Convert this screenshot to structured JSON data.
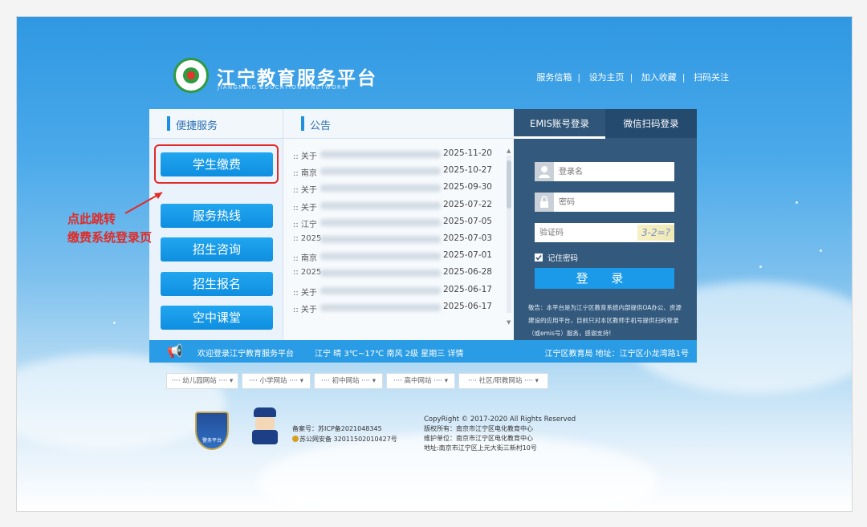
{
  "header": {
    "site_title": "江宁教育服务平台",
    "site_subtitle": "JIANGNING EDUCATION I NETWORK",
    "top_links": [
      "服务信箱",
      "设为主页",
      "加入收藏",
      "扫码关注"
    ]
  },
  "quick_services": {
    "heading": "便捷服务",
    "buttons": [
      "学生缴费",
      "服务热线",
      "招生咨询",
      "招生报名",
      "空中课堂"
    ]
  },
  "notices": {
    "heading": "公告",
    "items": [
      {
        "prefix": ":: 关于",
        "date": "2025-11-20"
      },
      {
        "prefix": ":: 南京",
        "date": "2025-10-27"
      },
      {
        "prefix": ":: 关于",
        "date": "2025-09-30"
      },
      {
        "prefix": ":: 关于",
        "date": "2025-07-22"
      },
      {
        "prefix": ":: 江宁",
        "date": "2025-07-05"
      },
      {
        "prefix": ":: 2025",
        "date": "2025-07-03"
      },
      {
        "prefix": ":: 南京",
        "date": "2025-07-01"
      },
      {
        "prefix": ":: 2025",
        "date": "2025-06-28"
      },
      {
        "prefix": ":: 关于",
        "date": "2025-06-17"
      },
      {
        "prefix": ":: 关于",
        "date": "2025-06-17"
      }
    ]
  },
  "login": {
    "tab_emis": "EMIS账号登录",
    "tab_wechat": "微信扫码登录",
    "username_placeholder": "登录名",
    "password_placeholder": "密码",
    "captcha_placeholder": "验证码",
    "captcha_text": "3-2=?",
    "remember_label": "记住密码",
    "login_button": "登 录",
    "note": "敬告：本平台是为江宁区教育系统内部提供OA办公、资源建设的应用平台，目前只对本区教师手机号提供扫码登录（或emis号）服务，感谢支持!"
  },
  "strip": {
    "welcome": "欢迎登录江宁教育服务平台",
    "weather": "江宁  晴 3℃~17℃  南风 2级  星期三  详情",
    "address": "江宁区教育局 地址：江宁区小龙湾路1号"
  },
  "dropdowns": [
    "···· 幼儿园网站 ···· ▾",
    "···· 小学网站 ···· ▾",
    "···· 初中网站 ···· ▾",
    "···· 高中网站 ···· ▾",
    "···· 社区/职教网站 ···· ▾"
  ],
  "footer": {
    "badge_text": "警务平台",
    "icp": "备案号：苏ICP备2021048345",
    "police": "苏公网安备 32011502010427号",
    "copyright": "CopyRight © 2017-2020 All Rights Reserved",
    "owner": "版权所有：南京市江宁区电化教育中心",
    "maintainer": "维护单位：南京市江宁区电化教育中心",
    "address": "地址:南京市江宁区上元大街三新村10号"
  },
  "annotation": {
    "line1": "点此跳转",
    "line2": "缴费系统登录页",
    "color": "#e02b26"
  },
  "colors": {
    "accent": "#1a9ae8",
    "login_panel": "#33597d",
    "highlight": "#e02b26"
  }
}
